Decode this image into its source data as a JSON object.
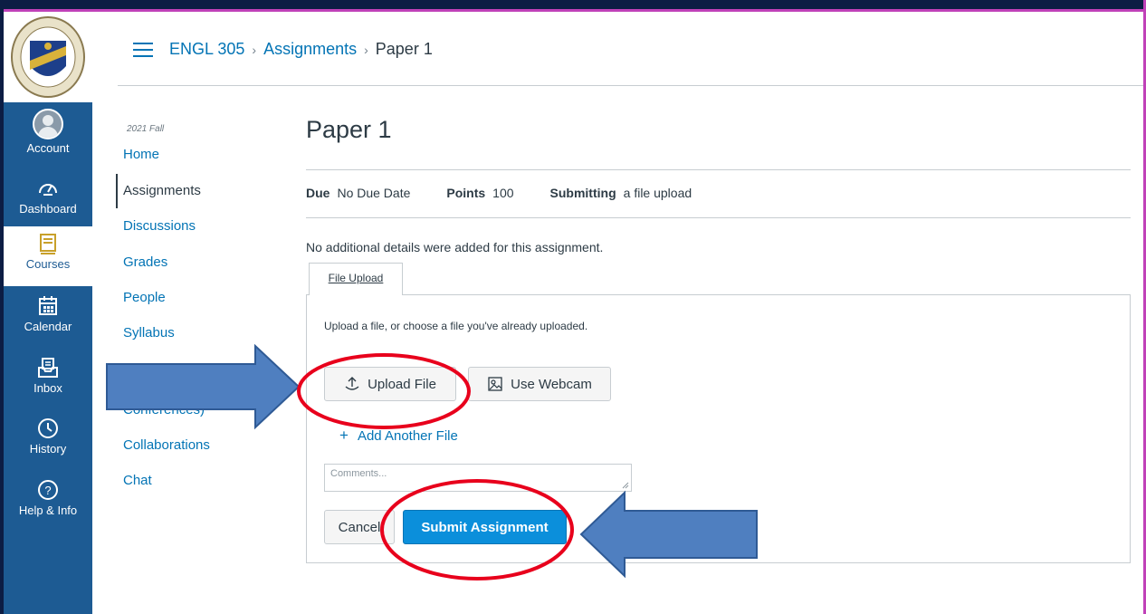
{
  "global_nav": {
    "items": [
      {
        "label": "Account",
        "icon": "avatar"
      },
      {
        "label": "Dashboard",
        "icon": "dashboard-icon"
      },
      {
        "label": "Courses",
        "icon": "courses-icon"
      },
      {
        "label": "Calendar",
        "icon": "calendar-icon"
      },
      {
        "label": "Inbox",
        "icon": "inbox-icon"
      },
      {
        "label": "History",
        "icon": "history-icon"
      },
      {
        "label": "Help & Info",
        "icon": "help-icon"
      }
    ]
  },
  "breadcrumb": {
    "course": "ENGL 305",
    "section": "Assignments",
    "current": "Paper 1"
  },
  "course_nav": {
    "term": "2021 Fall",
    "items": [
      "Home",
      "Assignments",
      "Discussions",
      "Grades",
      "People",
      "Syllabus",
      "Conferences)",
      "Collaborations",
      "Chat"
    ]
  },
  "assignment": {
    "title": "Paper 1",
    "due_label": "Due",
    "due_value": "No Due Date",
    "points_label": "Points",
    "points_value": "100",
    "submitting_label": "Submitting",
    "submitting_value": "a file upload",
    "details": "No additional details were added for this assignment."
  },
  "submission": {
    "tab": "File Upload",
    "hint": "Upload a file, or choose a file you've already uploaded.",
    "upload_button": "Upload File",
    "webcam_button": "Use Webcam",
    "add_file": "Add Another File",
    "comments_placeholder": "Comments...",
    "cancel_button": "Cancel",
    "submit_button": "Submit Assignment"
  },
  "colors": {
    "nav_bg": "#1d5b93",
    "link": "#0374b5",
    "submit": "#0b8fdb",
    "annotation_red": "#e8001c",
    "annotation_arrow": "#4f7fc0"
  }
}
